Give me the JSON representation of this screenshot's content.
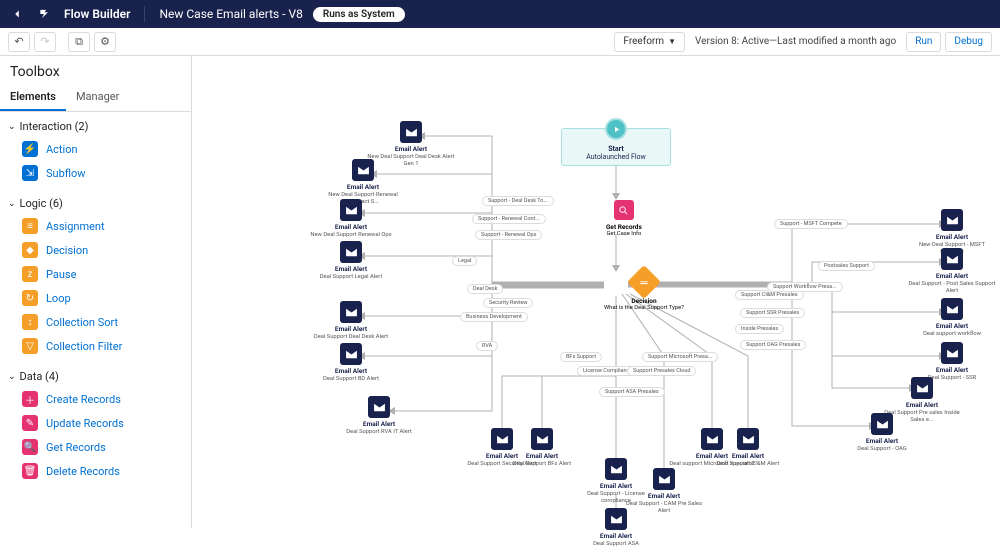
{
  "header": {
    "app_title": "Flow Builder",
    "flow_name": "New Case Email alerts - V8",
    "run_as": "Runs as System"
  },
  "toolbar": {
    "layout_mode": "Freeform",
    "version_text": "Version 8: Active—Last modified a month ago",
    "run": "Run",
    "debug": "Debug"
  },
  "sidebar": {
    "title": "Toolbox",
    "tabs": {
      "elements": "Elements",
      "manager": "Manager"
    },
    "groups": {
      "interaction": "Interaction (2)",
      "logic": "Logic (6)",
      "data": "Data (4)"
    },
    "items": {
      "action": "Action",
      "subflow": "Subflow",
      "assignment": "Assignment",
      "decision": "Decision",
      "pause": "Pause",
      "loop": "Loop",
      "collection_sort": "Collection Sort",
      "collection_filter": "Collection Filter",
      "create_records": "Create Records",
      "update_records": "Update Records",
      "get_records": "Get Records",
      "delete_records": "Delete Records"
    }
  },
  "canvas": {
    "start": {
      "title": "Start",
      "sub": "Autolaunched Flow"
    },
    "get_records": {
      "title": "Get Records",
      "sub": "Get Case Info"
    },
    "decision": {
      "title": "Decision",
      "sub": "What is the Deal Support Type?"
    },
    "email_alert_label": "Email Alert",
    "nodes": {
      "n1": "New Deal Support Deal Desk Alert Gen 1",
      "n2": "New Deal Support Renewal Contract S...",
      "n3": "New Deal Support Renewal Ops",
      "n4": "Deal Support Legal Alert",
      "n5": "Deal Support Deal Desk Alert",
      "n6": "Deal Support BD Alert",
      "n7": "Deal Support RVA IT Alert",
      "n8": "Deal Support Security Alert",
      "n9": "Deal Support BFs Alert",
      "n10": "Deal Support - License compliance",
      "n11": "Deal Support ASA",
      "n12": "Deal Support - CAM Pre Sales Alert",
      "n13": "Deal support Microsoft specialist",
      "n14": "Deal Support CI&M Alert",
      "n15": "Deal Support - OAG",
      "n16": "Deal Support Pre sales Inside Sales e...",
      "n17": "Deal Support - SSR",
      "n18": "Deal support workflow",
      "n19": "Deal Support - Post Sales Support Alert",
      "n20": "New Deal Support - MSFT Compete"
    },
    "edge_labels": {
      "e1": "Support - Deal Desk To...",
      "e2": "Support - Renewal Cont...",
      "e3": "Support - Renewal Ops",
      "e4": "Legal",
      "e5": "Deal Desk",
      "e6": "Security Review",
      "e7": "Business Development",
      "e8": "RVA",
      "e9": "BFs Support",
      "e10": "License Compliance",
      "e11": "Support Presales Cloud",
      "e12": "Support ASA Presales",
      "e13": "Support Microsoft Presa...",
      "e14": "Support CI&M Presales",
      "e15": "Support SSR Presales",
      "e16": "Inside Presales",
      "e17": "Support OAG Presales",
      "e18": "Support Workflow Presa...",
      "e19": "Postsales Support",
      "e20": "Support - MSFT Compete"
    }
  }
}
